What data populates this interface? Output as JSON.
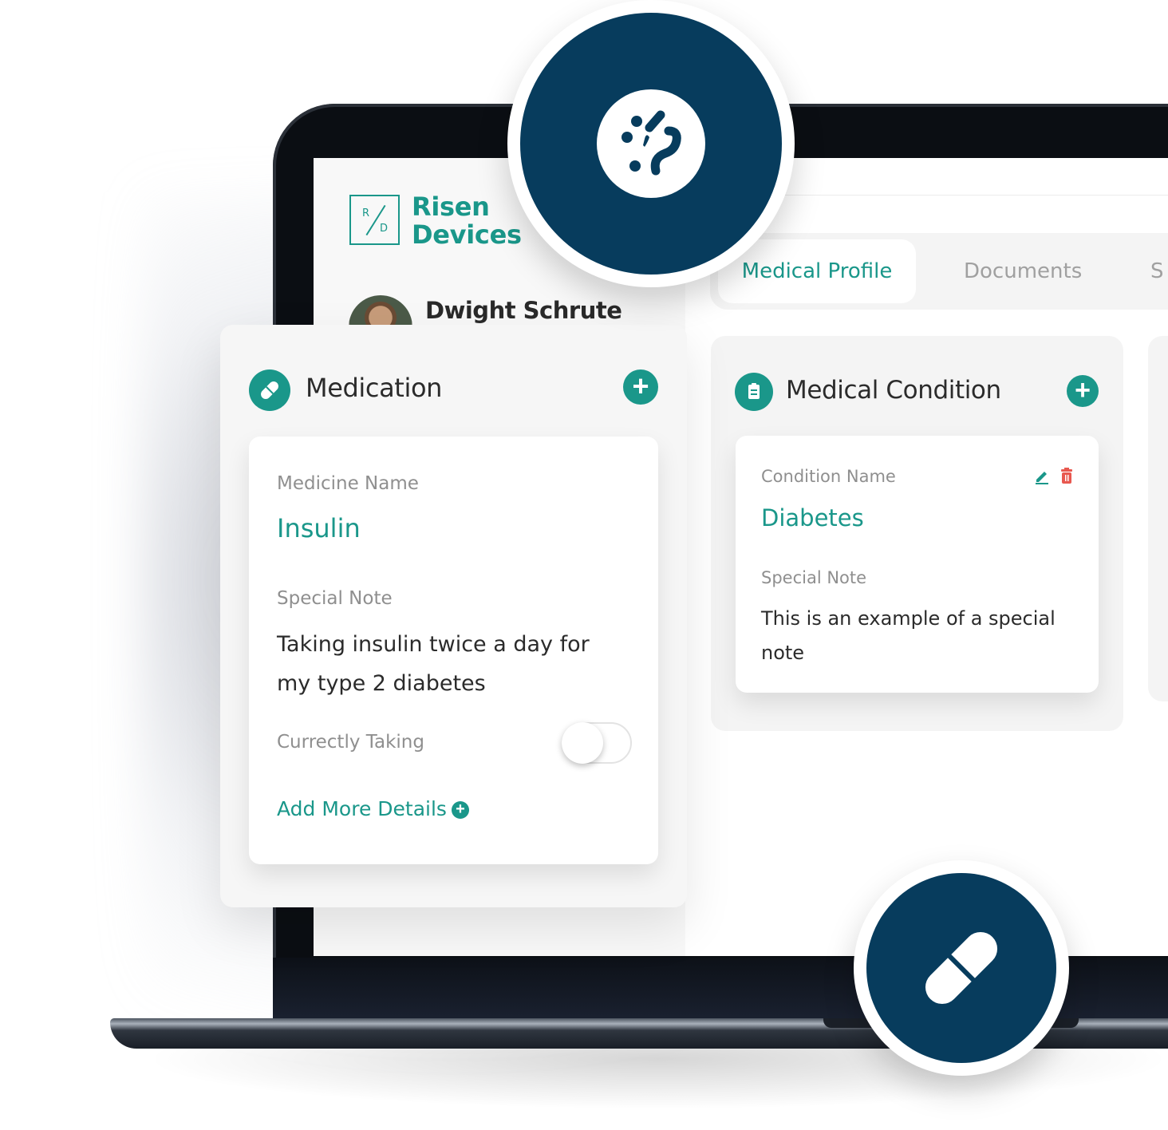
{
  "colors": {
    "accent": "#1a978a",
    "navy": "#073c5d",
    "danger": "#e8584f"
  },
  "brand": {
    "mark_r": "R",
    "mark_d": "D",
    "name_line1": "Risen",
    "name_line2": "Devices"
  },
  "user": {
    "name": "Dwight Schrute"
  },
  "tabs": [
    {
      "label": "Medical Profile",
      "active": true
    },
    {
      "label": "Documents",
      "active": false
    },
    {
      "label": "S",
      "active": false
    }
  ],
  "medication": {
    "title": "Medication",
    "icon": "pill-icon",
    "field_name_label": "Medicine Name",
    "field_name_value": "Insulin",
    "note_label": "Special Note",
    "note_value": "Taking insulin twice a day for my type 2 diabetes",
    "currently_label": "Currectly Taking",
    "currently_taking": false,
    "add_more_label": "Add More Details"
  },
  "condition": {
    "title": "Medical Condition",
    "icon": "clipboard-icon",
    "field_name_label": "Condition Name",
    "field_name_value": "Diabetes",
    "note_label": "Special Note",
    "note_value": "This is an example of a special note"
  },
  "floating_icons": [
    "bacteria-icon",
    "pill-icon"
  ]
}
